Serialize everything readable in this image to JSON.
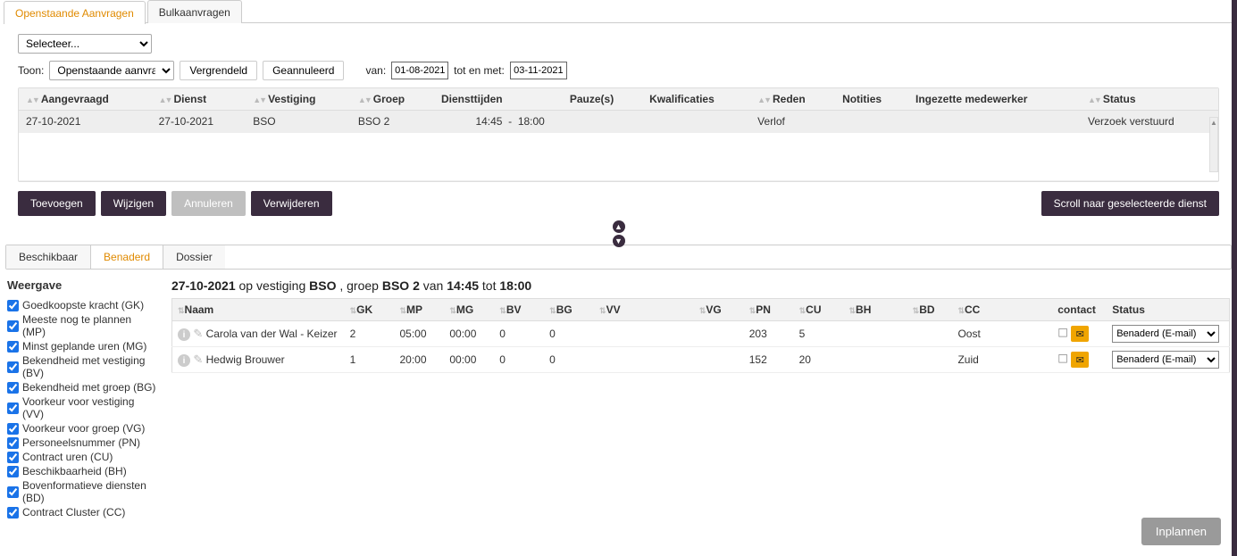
{
  "tabs": {
    "open": "Openstaande Aanvragen",
    "bulk": "Bulkaanvragen"
  },
  "selector_placeholder": "Selecteer...",
  "toon_label": "Toon:",
  "toon_value": "Openstaande aanvragen",
  "btn_vergrendeld": "Vergrendeld",
  "btn_geannuleerd": "Geannuleerd",
  "van_label": "van:",
  "van_value": "01-08-2021",
  "tot_label": "tot en met:",
  "tot_value": "03-11-2021",
  "headers": {
    "aangevraagd": "Aangevraagd",
    "dienst": "Dienst",
    "vestiging": "Vestiging",
    "groep": "Groep",
    "diensttijden": "Diensttijden",
    "pauzes": "Pauze(s)",
    "kwalificaties": "Kwalificaties",
    "reden": "Reden",
    "notities": "Notities",
    "medewerker": "Ingezette medewerker",
    "status": "Status"
  },
  "row": {
    "aangevraagd": "27-10-2021",
    "dienst": "27-10-2021",
    "vestiging": "BSO",
    "groep": "BSO 2",
    "start": "14:45",
    "sep": "-",
    "end": "18:00",
    "reden": "Verlof",
    "status": "Verzoek verstuurd"
  },
  "actions": {
    "toevoegen": "Toevoegen",
    "wijzigen": "Wijzigen",
    "annuleren": "Annuleren",
    "verwijderen": "Verwijderen",
    "scroll": "Scroll naar geselecteerde dienst"
  },
  "tabs2": {
    "beschikbaar": "Beschikbaar",
    "benaderd": "Benaderd",
    "dossier": "Dossier"
  },
  "sidebar": {
    "title": "Weergave",
    "items": [
      "Goedkoopste kracht (GK)",
      "Meeste nog te plannen (MP)",
      "Minst geplande uren (MG)",
      "Bekendheid met vestiging (BV)",
      "Bekendheid met groep (BG)",
      "Voorkeur voor vestiging (VV)",
      "Voorkeur voor groep (VG)",
      "Personeelsnummer (PN)",
      "Contract uren (CU)",
      "Beschikbaarheid (BH)",
      "Bovenformatieve diensten (BD)",
      "Contract Cluster (CC)"
    ]
  },
  "content_title": {
    "date": "27-10-2021",
    "t1": " op vestiging ",
    "vest": "BSO",
    "t2": " , groep ",
    "groep": "BSO 2",
    "t3": " van ",
    "from": "14:45",
    "t4": " tot ",
    "to": "18:00"
  },
  "emp_headers": {
    "naam": "Naam",
    "gk": "GK",
    "mp": "MP",
    "mg": "MG",
    "bv": "BV",
    "bg": "BG",
    "vv": "VV",
    "vg": "VG",
    "pn": "PN",
    "cu": "CU",
    "bh": "BH",
    "bd": "BD",
    "cc": "CC",
    "contact": "contact",
    "status": "Status"
  },
  "emp_rows": [
    {
      "naam": "Carola van der Wal - Keizer",
      "gk": "2",
      "mp": "05:00",
      "mg": "00:00",
      "bv": "0",
      "bg": "0",
      "vv": "",
      "vg": "",
      "pn": "203",
      "cu": "5",
      "bh": "",
      "bd": "",
      "cc": "Oost",
      "status": "Benaderd (E-mail)"
    },
    {
      "naam": "Hedwig Brouwer",
      "gk": "1",
      "mp": "20:00",
      "mg": "00:00",
      "bv": "0",
      "bg": "0",
      "vv": "",
      "vg": "",
      "pn": "152",
      "cu": "20",
      "bh": "",
      "bd": "",
      "cc": "Zuid",
      "status": "Benaderd (E-mail)"
    }
  ],
  "inplannen": "Inplannen"
}
